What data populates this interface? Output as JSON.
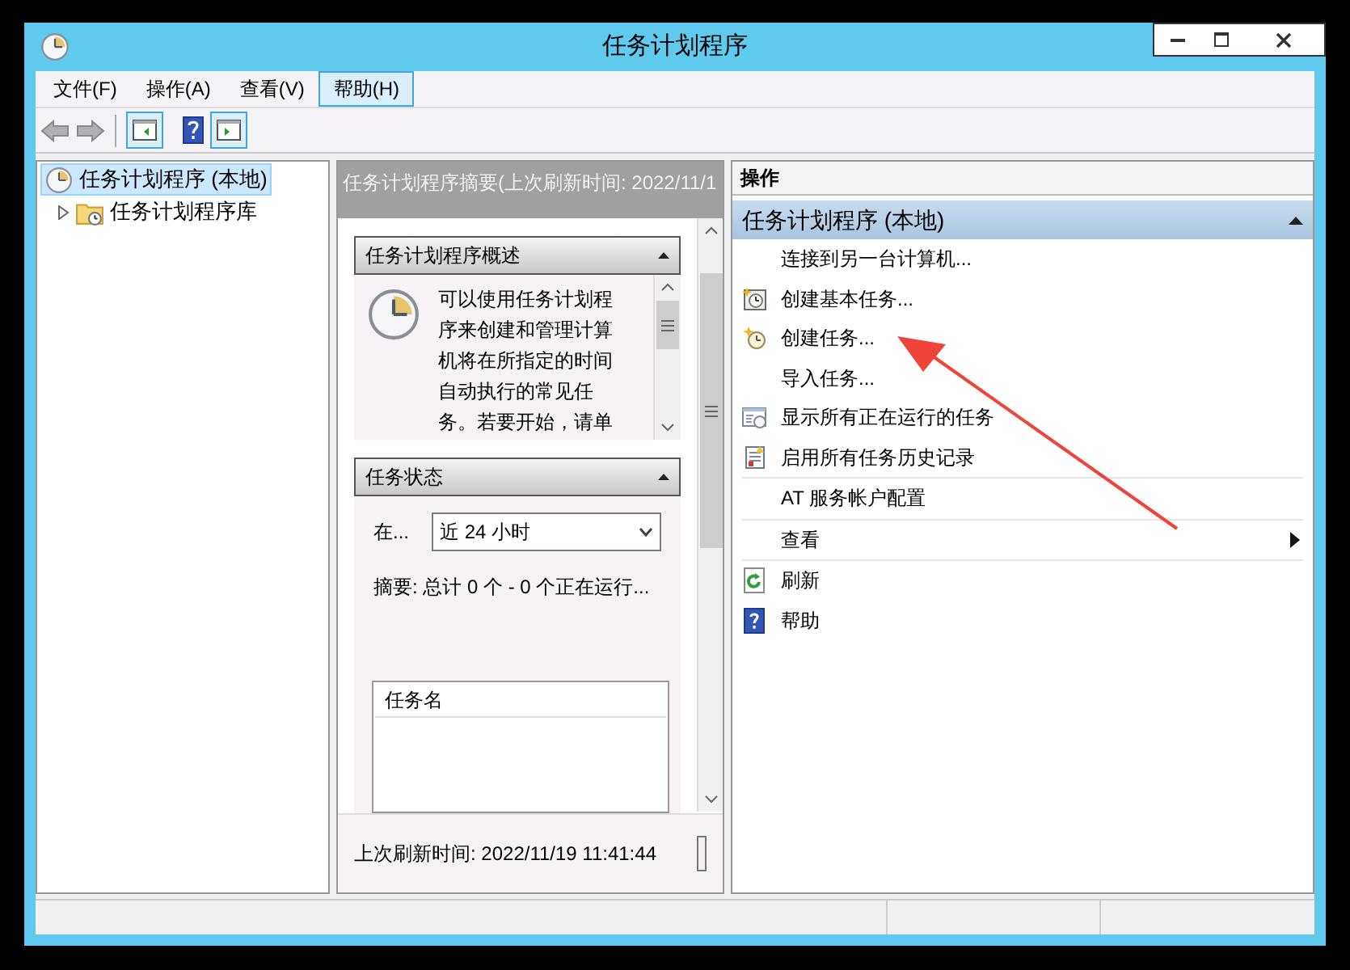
{
  "window": {
    "title": "任务计划程序"
  },
  "menu": [
    {
      "label": "文件(F)",
      "selected": false
    },
    {
      "label": "操作(A)",
      "selected": false
    },
    {
      "label": "查看(V)",
      "selected": false
    },
    {
      "label": "帮助(H)",
      "selected": true
    }
  ],
  "tree": [
    {
      "label": "任务计划程序 (本地)",
      "selected": true
    },
    {
      "label": "任务计划程序库",
      "selected": false,
      "expanded": false
    }
  ],
  "summary": {
    "title": "任务计划程序摘要(上次刷新时间: 2022/11/1",
    "overview": {
      "title": "任务计划程序概述",
      "text_lines": [
        "可以使用任务计划程",
        "序来创建和管理计算",
        "机将在所指定的时间",
        "自动执行的常见任",
        "务。若要开始，请单"
      ]
    },
    "status": {
      "title": "任务状态",
      "period_label": "在...",
      "period_value": "近 24 小时",
      "summary": "摘要: 总计 0 个 - 0 个正在运行...",
      "columns": [
        "任务名"
      ]
    },
    "last_refresh": "上次刷新时间: 2022/11/19 11:41:44"
  },
  "actions": {
    "title": "操作",
    "group_title": "任务计划程序 (本地)",
    "expanded": true,
    "groups": [
      [
        {
          "label": "连接到另一台计算机...",
          "submenu": false
        },
        {
          "label": "创建基本任务...",
          "submenu": false
        },
        {
          "label": "创建任务...",
          "submenu": false
        },
        {
          "label": "导入任务...",
          "submenu": false
        },
        {
          "label": "显示所有正在运行的任务",
          "submenu": false
        },
        {
          "label": "启用所有任务历史记录",
          "submenu": false
        }
      ],
      [
        {
          "label": "AT 服务帐户配置",
          "submenu": false
        }
      ],
      [
        {
          "label": "查看",
          "submenu": true
        }
      ],
      [
        {
          "label": "刷新",
          "submenu": false
        },
        {
          "label": "帮助",
          "submenu": false
        }
      ]
    ]
  }
}
